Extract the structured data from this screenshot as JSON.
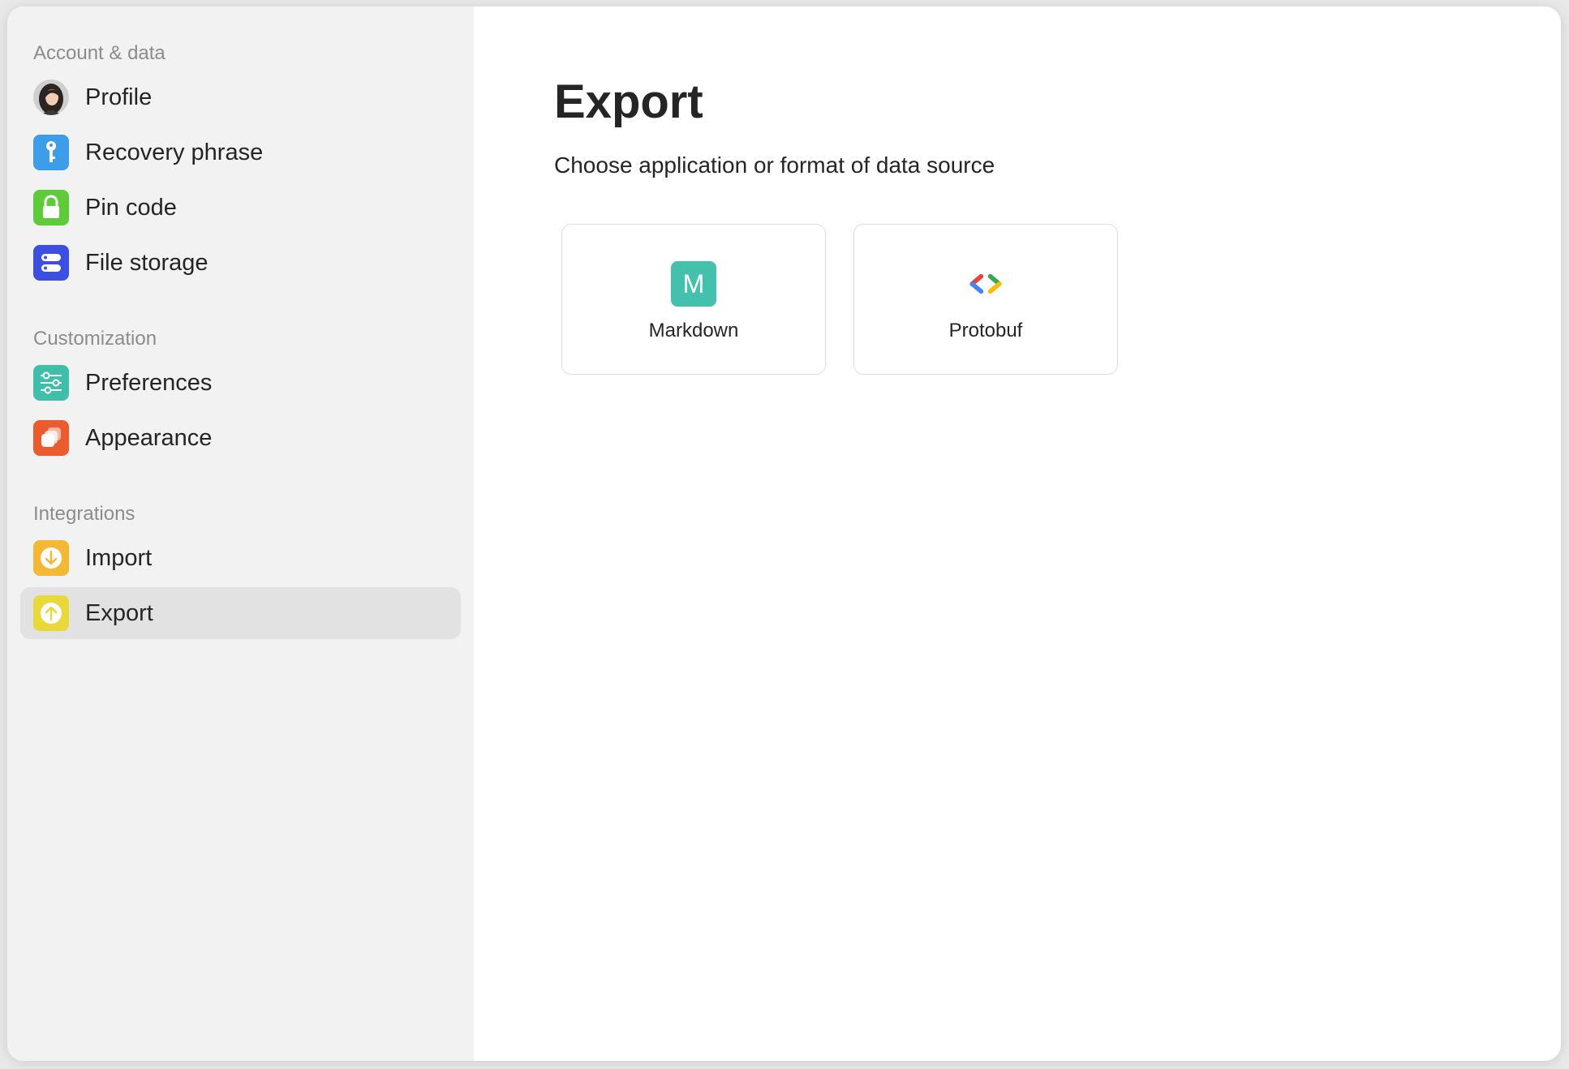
{
  "sidebar": {
    "sections": [
      {
        "label": "Account & data"
      },
      {
        "label": "Customization"
      },
      {
        "label": "Integrations"
      }
    ],
    "items": [
      {
        "label": "Profile",
        "icon": "avatar-icon"
      },
      {
        "label": "Recovery phrase",
        "icon": "key-icon",
        "color": "#3d9de8"
      },
      {
        "label": "Pin code",
        "icon": "lock-icon",
        "color": "#5dcb3a"
      },
      {
        "label": "File storage",
        "icon": "storage-icon",
        "color": "#3c4fe0"
      },
      {
        "label": "Preferences",
        "icon": "sliders-icon",
        "color": "#3fbfa9"
      },
      {
        "label": "Appearance",
        "icon": "appearance-icon",
        "color": "#ec5b2d"
      },
      {
        "label": "Import",
        "icon": "download-icon",
        "color": "#f5b834"
      },
      {
        "label": "Export",
        "icon": "upload-icon",
        "color": "#e8d83a",
        "active": true
      }
    ]
  },
  "main": {
    "title": "Export",
    "subtitle": "Choose application or format of data source",
    "cards": [
      {
        "label": "Markdown",
        "icon": "markdown-icon",
        "icon_text": "M",
        "color": "#43c1ad"
      },
      {
        "label": "Protobuf",
        "icon": "protobuf-icon"
      }
    ]
  }
}
